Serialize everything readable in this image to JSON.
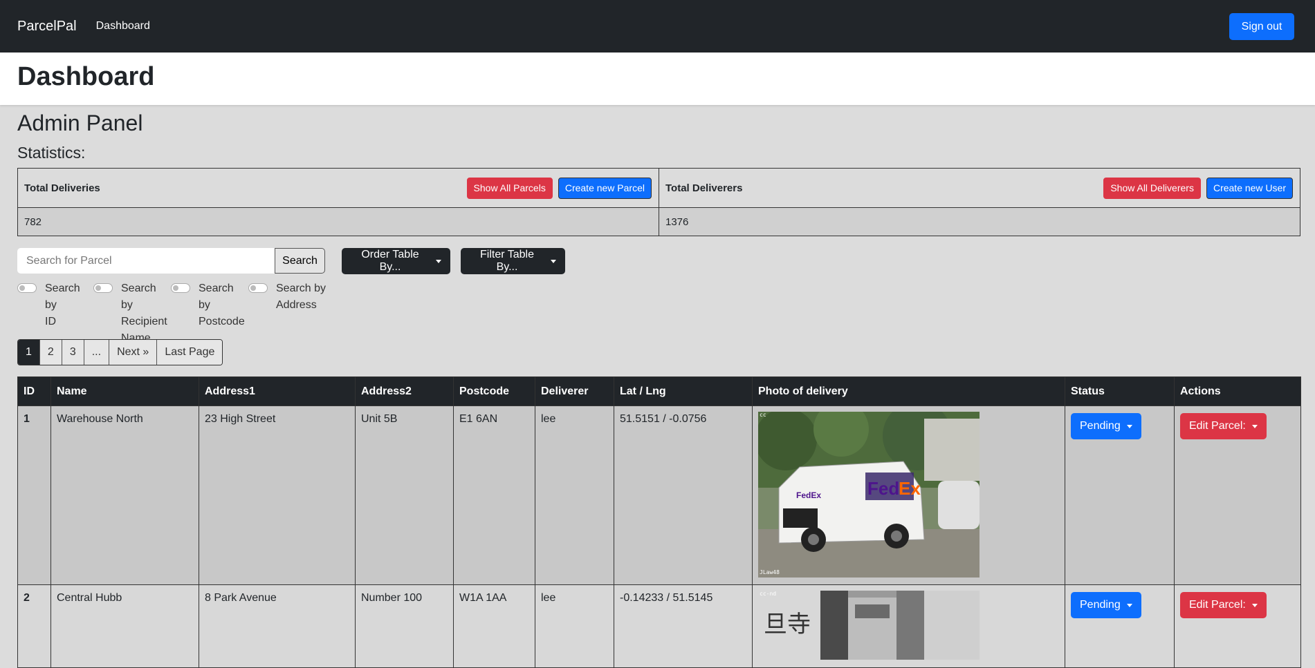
{
  "navbar": {
    "brand": "ParcelPal",
    "link": "Dashboard",
    "signout": "Sign out"
  },
  "header": {
    "title": "Dashboard"
  },
  "admin_title": "Admin Panel",
  "stats_title": "Statistics:",
  "stats": {
    "deliveries": {
      "label": "Total Deliveries",
      "value": "782",
      "show_btn": "Show All Parcels",
      "create_btn": "Create new Parcel"
    },
    "deliverers": {
      "label": "Total Deliverers",
      "value": "1376",
      "show_btn": "Show All Deliverers",
      "create_btn": "Create new User"
    }
  },
  "search": {
    "placeholder": "Search for Parcel",
    "button": "Search"
  },
  "order_dropdown": "Order Table By...",
  "filter_dropdown": "Filter Table By...",
  "search_options": [
    {
      "line1": "Search by",
      "line2": "ID",
      "line3": ""
    },
    {
      "line1": "Search by",
      "line2": "Recipient",
      "line3": "Name"
    },
    {
      "line1": "Search by",
      "line2": "Postcode",
      "line3": ""
    },
    {
      "line1": "Search by",
      "line2": "Address",
      "line3": ""
    }
  ],
  "pagination": [
    "1",
    "2",
    "3",
    "...",
    "Next »",
    "Last Page"
  ],
  "table": {
    "headers": [
      "ID",
      "Name",
      "Address1",
      "Address2",
      "Postcode",
      "Deliverer",
      "Lat / Lng",
      "Photo of delivery",
      "Status",
      "Actions"
    ],
    "rows": [
      {
        "id": "1",
        "name": "Warehouse North",
        "address1": "23 High Street",
        "address2": "Unit 5B",
        "postcode": "E1 6AN",
        "deliverer": "lee",
        "latlng": "51.5151 / -0.0756",
        "photo_tag": "cc",
        "photo_credit": "JLaw48",
        "status": "Pending",
        "action": "Edit Parcel:"
      },
      {
        "id": "2",
        "name": "Central Hubb",
        "address1": "8 Park Avenue",
        "address2": "Number 100",
        "postcode": "W1A 1AA",
        "deliverer": "lee",
        "latlng": "-0.14233 / 51.5145",
        "photo_tag": "cc-nd",
        "photo_credit": "",
        "status": "Pending",
        "action": "Edit Parcel:"
      }
    ]
  },
  "colors": {
    "primary": "#0d6efd",
    "danger": "#dc3545",
    "dark": "#212529"
  }
}
